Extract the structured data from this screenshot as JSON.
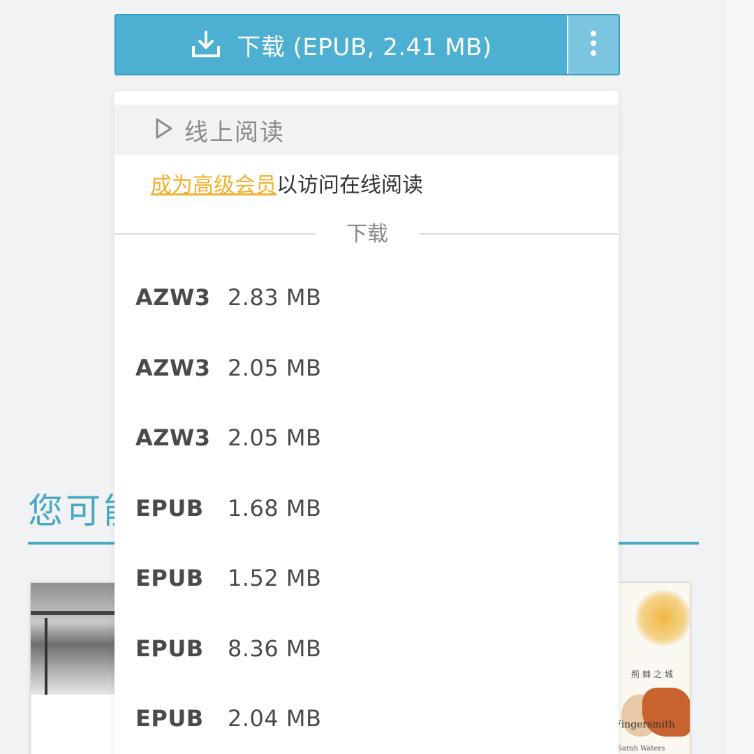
{
  "download_button": {
    "label": "下载 (EPUB, 2.41 MB)",
    "icon": "download-icon",
    "more_icon": "more-vertical-icon",
    "color": "#4db0d3"
  },
  "dropdown": {
    "read_online": {
      "label": "线上阅读",
      "icon": "play-icon"
    },
    "premium_note": {
      "link": "成为高级会员",
      "text": "以访问在线阅读",
      "link_color": "#f0b030"
    },
    "download_section": {
      "label": "下载"
    },
    "files": [
      {
        "format": "AZW3",
        "size": "2.83 MB"
      },
      {
        "format": "AZW3",
        "size": "2.05 MB"
      },
      {
        "format": "AZW3",
        "size": "2.05 MB"
      },
      {
        "format": "EPUB",
        "size": "1.68 MB"
      },
      {
        "format": "EPUB",
        "size": "1.52 MB"
      },
      {
        "format": "EPUB",
        "size": "8.36 MB"
      },
      {
        "format": "EPUB",
        "size": "2.04 MB"
      }
    ]
  },
  "background": {
    "section_title": "您可能",
    "accent_color": "#49a7c6",
    "book_right": {
      "title_cn": "荊棘之城",
      "title_en": "Fingersmith",
      "author": "Sarah Waters"
    }
  }
}
